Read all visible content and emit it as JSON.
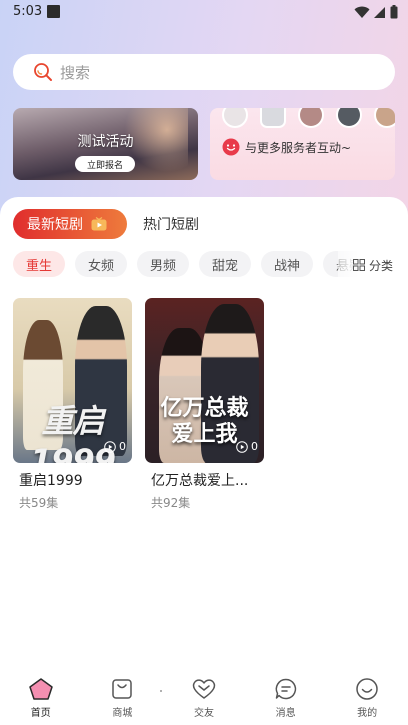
{
  "status_bar": {
    "time": "5:03"
  },
  "search": {
    "placeholder": "搜索"
  },
  "banners": {
    "left": {
      "title": "测试活动",
      "button": "立即报名"
    },
    "right": {
      "text": "与更多服务者互动~"
    }
  },
  "tabs": [
    {
      "label": "最新短剧",
      "active": true
    },
    {
      "label": "热门短剧",
      "active": false
    }
  ],
  "chips": [
    {
      "label": "重生",
      "active": true
    },
    {
      "label": "女频"
    },
    {
      "label": "男频"
    },
    {
      "label": "甜宠"
    },
    {
      "label": "战神"
    },
    {
      "label": "悬疑"
    }
  ],
  "category_button": "分类",
  "dramas": [
    {
      "poster_title": "重启1999",
      "name": "重启1999",
      "episodes": "共59集",
      "play_count": "0"
    },
    {
      "poster_title": "亿万总裁爱上我",
      "name": "亿万总裁爱上...",
      "episodes": "共92集",
      "play_count": "0"
    }
  ],
  "bottom_nav": [
    {
      "label": "首页",
      "icon": "home-icon",
      "active": true
    },
    {
      "label": "商城",
      "icon": "shop-bag-icon"
    },
    {
      "label": "交友",
      "icon": "heart-icon"
    },
    {
      "label": "消息",
      "icon": "message-icon"
    },
    {
      "label": "我的",
      "icon": "profile-smile-icon"
    }
  ],
  "colors": {
    "accent_red": "#e53935",
    "accent_orange": "#ee7b3c",
    "home_icon": "#f06292"
  }
}
